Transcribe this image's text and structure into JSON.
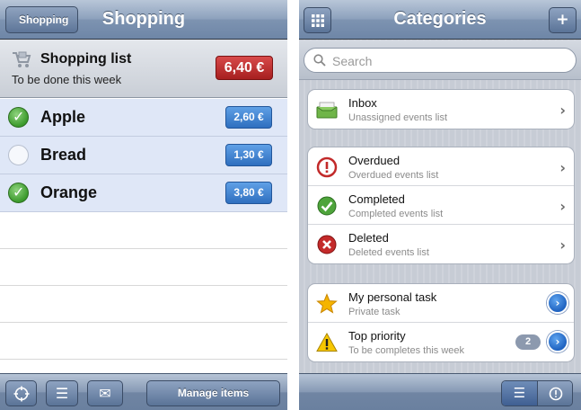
{
  "left": {
    "nav": {
      "back_label": "Shopping",
      "title": "Shopping"
    },
    "list_header": {
      "title": "Shopping list",
      "subtitle": "To be done this week",
      "total": "6,40 €"
    },
    "items": [
      {
        "name": "Apple",
        "price": "2,60 €",
        "checked": true
      },
      {
        "name": "Bread",
        "price": "1,30 €",
        "checked": false
      },
      {
        "name": "Orange",
        "price": "3,80 €",
        "checked": true
      }
    ],
    "toolbar": {
      "manage_label": "Manage items",
      "icons": [
        "crosshair-icon",
        "list-icon",
        "mail-icon"
      ]
    }
  },
  "right": {
    "nav": {
      "title": "Categories",
      "left_icon": "grid-icon",
      "right_icon": "plus-icon"
    },
    "search": {
      "placeholder": "Search"
    },
    "groups": [
      [
        {
          "title": "Inbox",
          "subtitle": "Unassigned events list",
          "icon": "inbox-icon"
        }
      ],
      [
        {
          "title": "Overdued",
          "subtitle": "Overdued events list",
          "icon": "overdue-icon"
        },
        {
          "title": "Completed",
          "subtitle": "Completed events list",
          "icon": "completed-icon"
        },
        {
          "title": "Deleted",
          "subtitle": "Deleted events list",
          "icon": "deleted-icon"
        }
      ],
      [
        {
          "title": "My personal task",
          "subtitle": "Private task",
          "icon": "star-icon"
        },
        {
          "title": "Top priority",
          "subtitle": "To be completes this week",
          "icon": "warning-icon",
          "count": "2"
        }
      ]
    ],
    "toolbar": {
      "icons": [
        "list-icon",
        "alert-icon"
      ]
    }
  },
  "colors": {
    "nav_blue": "#7d93b1",
    "total_red": "#c03030",
    "price_blue": "#3f80d0",
    "item_bg": "#dfe7f7"
  }
}
